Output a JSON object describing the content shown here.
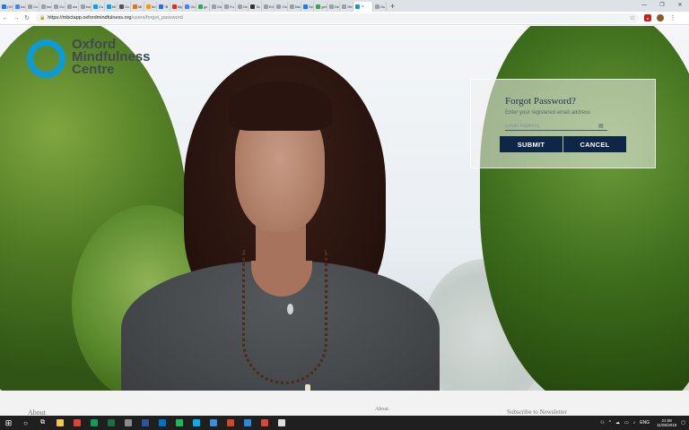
{
  "browser": {
    "tabs": [
      {
        "label": "(20",
        "color": "#1877f2"
      },
      {
        "label": "Da",
        "color": "#4285f4"
      },
      {
        "label": "Co",
        "color": "#9aa0a6"
      },
      {
        "label": "Inn",
        "color": "#9aa0a6"
      },
      {
        "label": "Co",
        "color": "#9aa0a6"
      },
      {
        "label": "wo",
        "color": "#9aa0a6"
      },
      {
        "label": "Inn",
        "color": "#9aa0a6"
      },
      {
        "label": "Co",
        "color": "#00a4ef"
      },
      {
        "label": "Mi",
        "color": "#00a4ef"
      },
      {
        "label": "Co",
        "color": "#555555"
      },
      {
        "label": "Mi",
        "color": "#e8710a"
      },
      {
        "label": "Am",
        "color": "#ff9900"
      },
      {
        "label": "\"B",
        "color": "#1a73e8"
      },
      {
        "label": "My",
        "color": "#d93025"
      },
      {
        "label": "Go",
        "color": "#4285f4"
      },
      {
        "label": "go",
        "color": "#34a853"
      },
      {
        "label": "OU",
        "color": "#9aa0a6"
      },
      {
        "label": "Fu",
        "color": "#9aa0a6"
      },
      {
        "label": "Ox",
        "color": "#9aa0a6"
      },
      {
        "label": "Ta",
        "color": "#333333"
      },
      {
        "label": "Edi",
        "color": "#9aa0a6"
      },
      {
        "label": "OU",
        "color": "#9aa0a6"
      },
      {
        "label": "Ma",
        "color": "#9aa0a6"
      },
      {
        "label": "Ox",
        "color": "#1877f2"
      },
      {
        "label": "get",
        "color": "#34a853"
      },
      {
        "label": "De",
        "color": "#9aa0a6"
      },
      {
        "label": "Re",
        "color": "#9aa0a6"
      },
      {
        "label": "",
        "color": "#0a9bd8",
        "active": true
      },
      {
        "label": "Ou",
        "color": "#9aa0a6"
      }
    ],
    "new_tab": "+",
    "window_controls": [
      "—",
      "❐",
      "✕"
    ],
    "url_host": "https://mbctapp.oxfordmindfulness.org",
    "url_path": "/users/forgot_password"
  },
  "logo": {
    "line1": "Oxford",
    "line2": "Mindfulness",
    "line3": "Centre",
    "ring_color": "#0a9bd8"
  },
  "form": {
    "title": "Forgot Password?",
    "subtitle": "Enter your registered email address",
    "email_placeholder": "Email Address",
    "email_value": "",
    "submit_label": "SUBMIT",
    "cancel_label": "CANCEL",
    "button_color": "#0e2747"
  },
  "footer": {
    "col1": "About",
    "col2": "About",
    "col3": "Subscribe to Newsletter"
  },
  "taskbar": {
    "apps": [
      {
        "name": "file-explorer",
        "color": "#f2c94c"
      },
      {
        "name": "chrome",
        "color": "#db4437"
      },
      {
        "name": "chrome-2",
        "color": "#0f9d58"
      },
      {
        "name": "excel",
        "color": "#1d6f42"
      },
      {
        "name": "app-grey",
        "color": "#8a8a8a"
      },
      {
        "name": "word",
        "color": "#2b579a"
      },
      {
        "name": "outlook",
        "color": "#0072c6"
      },
      {
        "name": "spotify",
        "color": "#1db954"
      },
      {
        "name": "skype",
        "color": "#00aff0"
      },
      {
        "name": "onedrive",
        "color": "#3c8ddb"
      },
      {
        "name": "powerpoint",
        "color": "#d24726"
      },
      {
        "name": "photos-blue",
        "color": "#2b88d8"
      },
      {
        "name": "chrome-3",
        "color": "#db4437"
      },
      {
        "name": "photos",
        "color": "#dddddd"
      }
    ],
    "lang": "ENG",
    "time": "21:08",
    "date": "11/05/2019"
  }
}
